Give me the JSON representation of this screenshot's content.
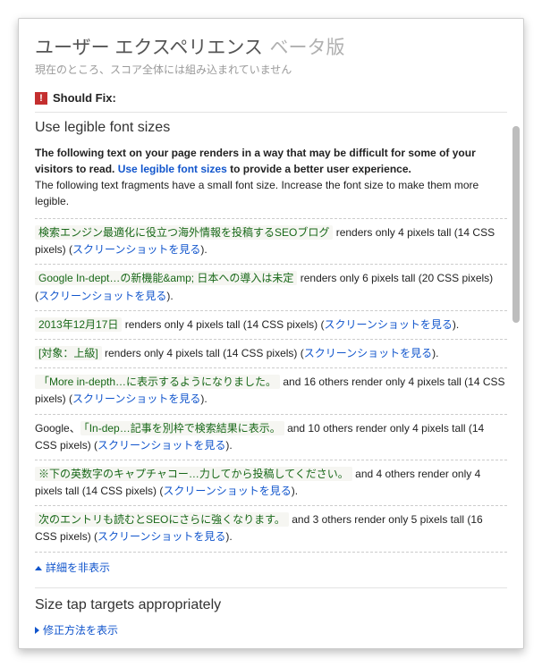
{
  "header": {
    "title": "ユーザー エクスペリエンス",
    "beta": "ベータ版",
    "subtitle": "現在のところ、スコア全体には組み込まれていません"
  },
  "shouldFix": {
    "iconGlyph": "!",
    "label": "Should Fix:"
  },
  "section1": {
    "title": "Use legible font sizes",
    "intro_bold": "The following text on your page renders in a way that may be difficult for some of your visitors to read. ",
    "intro_link": "Use legible font sizes",
    "intro_bold2": " to provide a better user experience.",
    "intro_plain": "The following text fragments have a small font size. Increase the font size to make them more legible.",
    "screenshot_link": "スクリーンショットを見る",
    "items": [
      {
        "snippet": "検索エンジン最適化に役立つ海外情報を投稿するSEOブログ",
        "desc": " renders only 4 pixels tall (14 CSS pixels) ("
      },
      {
        "snippet": "Google In-dept…の新機能&amp; 日本への導入は未定",
        "desc": " renders only 6 pixels tall (20 CSS pixels) ("
      },
      {
        "snippet": "2013年12月17日",
        "desc": " renders only 4 pixels tall (14 CSS pixels) ("
      },
      {
        "snippet": "[対象：上級]",
        "desc": " renders only 4 pixels tall (14 CSS pixels) ("
      },
      {
        "snippet": "「More in-depth…に表示するようになりました。",
        "desc": " and 16 others render only 4 pixels tall (14 CSS pixels) ("
      },
      {
        "snippet_pre": "Google、",
        "snippet": "「In-dep…記事を別枠で検索結果に表示。",
        "desc": " and 10 others render only 4 pixels tall (14 CSS pixels) ("
      },
      {
        "snippet": "※下の英数字のキャプチャコー…力してから投稿してください。",
        "desc": " and 4 others render only 4 pixels tall (14 CSS pixels) ("
      },
      {
        "snippet": "次のエントリも読むとSEOにさらに強くなります。",
        "desc": " and 3 others render only 5 pixels tall (16 CSS pixels) ("
      }
    ],
    "collapse": "詳細を非表示"
  },
  "section2": {
    "title": "Size tap targets appropriately",
    "expand": "修正方法を表示"
  }
}
